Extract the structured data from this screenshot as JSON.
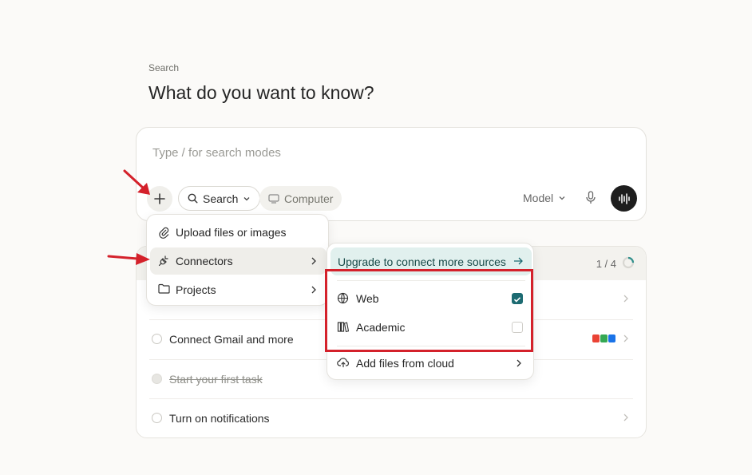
{
  "header": {
    "eyebrow": "Search",
    "title": "What do you want to know?"
  },
  "query": {
    "placeholder": "Type / for search modes",
    "mode_label": "Search",
    "computer_label": "Computer",
    "model_label": "Model"
  },
  "attach_menu": {
    "items": [
      {
        "label": "Upload files or images",
        "icon": "paperclip-icon"
      },
      {
        "label": "Connectors",
        "icon": "plug-icon",
        "active": true
      },
      {
        "label": "Projects",
        "icon": "folder-icon"
      }
    ]
  },
  "connectors_menu": {
    "upgrade_label": "Upgrade to connect more sources",
    "sources": [
      {
        "label": "Web",
        "icon": "globe-icon",
        "checked": true
      },
      {
        "label": "Academic",
        "icon": "books-icon",
        "checked": false
      }
    ],
    "cloud_label": "Add files from cloud"
  },
  "tasks": {
    "progress": "1 / 4",
    "progress_fraction": 0.25,
    "items": [
      {
        "label": "Connect Gmail and more",
        "done": false
      },
      {
        "label": "Start your first task",
        "done": true
      },
      {
        "label": "Turn on notifications",
        "done": false
      }
    ]
  },
  "colors": {
    "accent": "#1d6b72",
    "annotation": "#d4212b",
    "upgrade_bg": "#e1f0ee"
  }
}
